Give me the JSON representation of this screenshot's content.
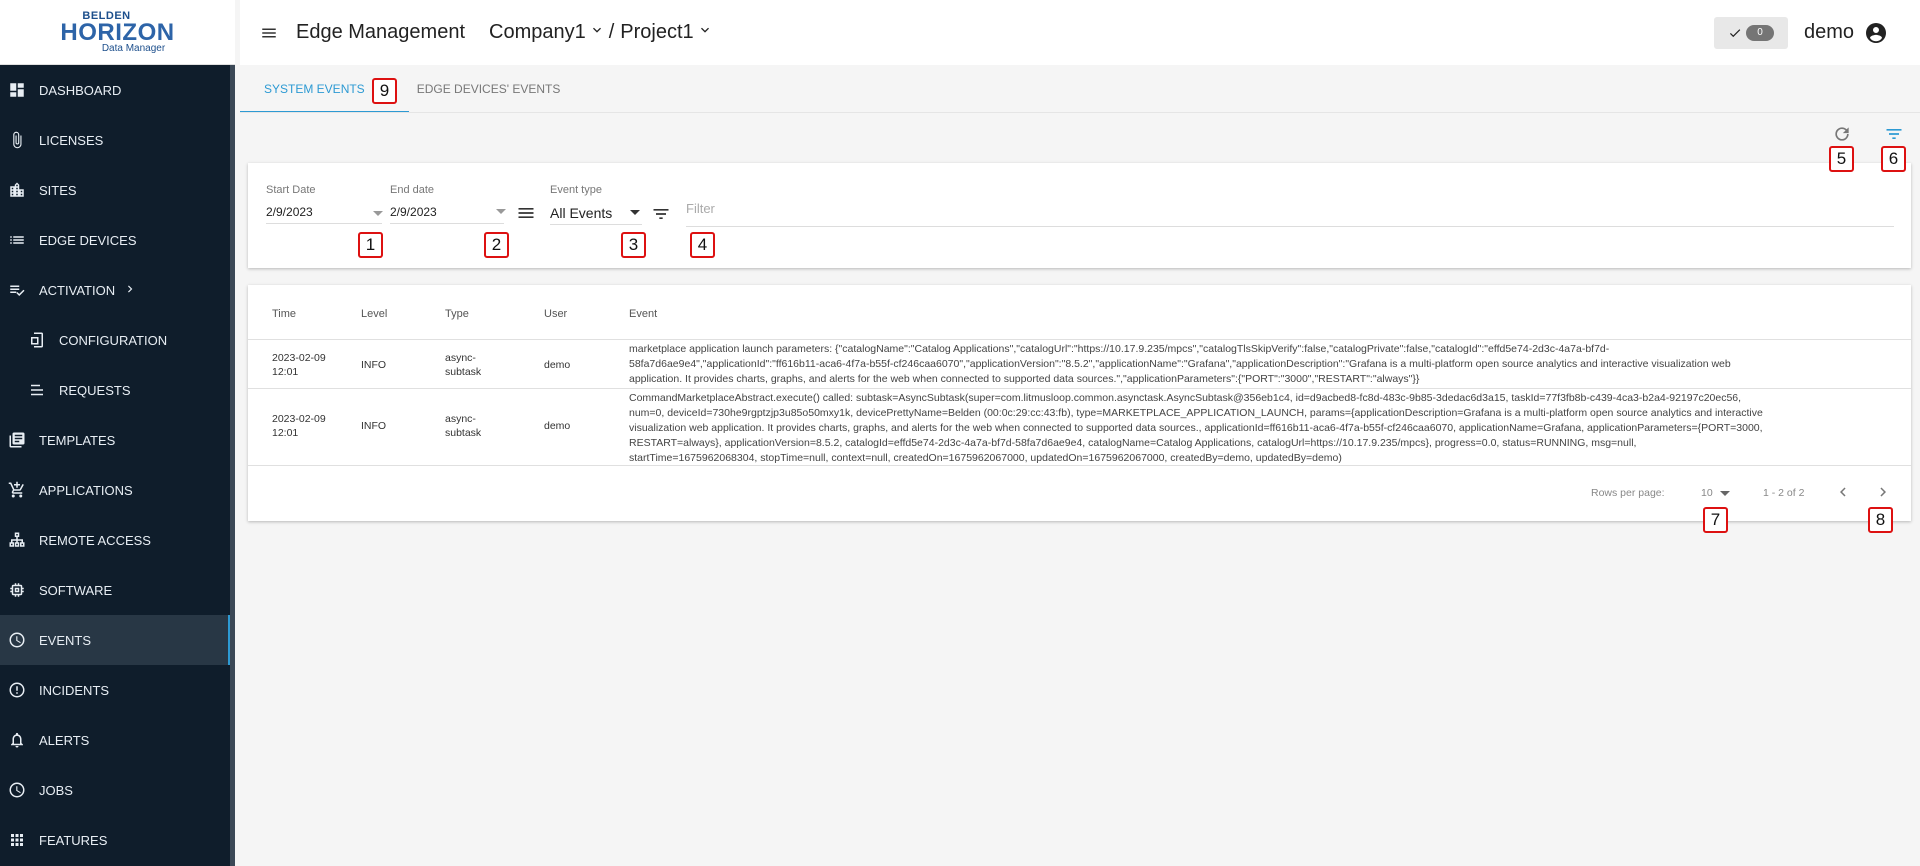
{
  "logo": {
    "line1": "BELDEN",
    "line2": "HORIZON",
    "line3": "Data Manager"
  },
  "sidebar": {
    "items": [
      {
        "label": "DASHBOARD",
        "icon": "dashboard-icon"
      },
      {
        "label": "LICENSES",
        "icon": "paperclip-icon"
      },
      {
        "label": "SITES",
        "icon": "building-icon"
      },
      {
        "label": "EDGE DEVICES",
        "icon": "list-icon"
      },
      {
        "label": "ACTIVATION",
        "icon": "checklist-icon"
      },
      {
        "label": "CONFIGURATION",
        "icon": "config-file-icon"
      },
      {
        "label": "REQUESTS",
        "icon": "list-lines-icon"
      },
      {
        "label": "TEMPLATES",
        "icon": "library-icon"
      },
      {
        "label": "APPLICATIONS",
        "icon": "cart-icon"
      },
      {
        "label": "REMOTE ACCESS",
        "icon": "network-icon"
      },
      {
        "label": "SOFTWARE",
        "icon": "chip-icon"
      },
      {
        "label": "EVENTS",
        "icon": "history-icon"
      },
      {
        "label": "INCIDENTS",
        "icon": "alert-circle-icon"
      },
      {
        "label": "ALERTS",
        "icon": "bell-icon"
      },
      {
        "label": "JOBS",
        "icon": "clock-icon"
      },
      {
        "label": "FEATURES",
        "icon": "apps-grid-icon"
      }
    ]
  },
  "header": {
    "title": "Edge Management",
    "company": "Company1",
    "separator": "/",
    "project": "Project1",
    "badge_count": "0",
    "user": "demo"
  },
  "tabs": [
    {
      "label": "SYSTEM EVENTS",
      "active": true
    },
    {
      "label": "EDGE DEVICES' EVENTS",
      "active": false
    }
  ],
  "filters": {
    "start_label": "Start Date",
    "start_value": "2/9/2023",
    "end_label": "End date",
    "end_value": "2/9/2023",
    "type_label": "Event type",
    "type_value": "All Events",
    "filter_placeholder": "Filter"
  },
  "table": {
    "columns": [
      "Time",
      "Level",
      "Type",
      "User",
      "Event"
    ],
    "rows": [
      {
        "time": "2023-02-09 12:01",
        "level": "INFO",
        "type": "async-subtask",
        "user": "demo",
        "event": "marketplace application launch parameters: {\"catalogName\":\"Catalog Applications\",\"catalogUrl\":\"https://10.17.9.235/mpcs\",\"catalogTlsSkipVerify\":false,\"catalogPrivate\":false,\"catalogId\":\"effd5e74-2d3c-4a7a-bf7d-58fa7d6ae9e4\",\"applicationId\":\"ff616b11-aca6-4f7a-b55f-cf246caa6070\",\"applicationVersion\":\"8.5.2\",\"applicationName\":\"Grafana\",\"applicationDescription\":\"Grafana is a multi-platform open source analytics and interactive visualization web application. It provides charts, graphs, and alerts for the web when connected to supported data sources.\",\"applicationParameters\":{\"PORT\":\"3000\",\"RESTART\":\"always\"}}"
      },
      {
        "time": "2023-02-09 12:01",
        "level": "INFO",
        "type": "async-subtask",
        "user": "demo",
        "event": "CommandMarketplaceAbstract.execute() called: subtask=AsyncSubtask(super=com.litmusloop.common.asynctask.AsyncSubtask@356eb1c4, id=d9acbed8-fc8d-483c-9b85-3dedac6d3a15, taskId=77f3fb8b-c439-4ca3-b2a4-92197c20ec56, num=0, deviceId=730he9rgptzjp3u85o50mxy1k, devicePrettyName=Belden (00:0c:29:cc:43:fb), type=MARKETPLACE_APPLICATION_LAUNCH, params={applicationDescription=Grafana is a multi-platform open source analytics and interactive visualization web application. It provides charts, graphs, and alerts for the web when connected to supported data sources., applicationId=ff616b11-aca6-4f7a-b55f-cf246caa6070, applicationName=Grafana, applicationParameters={PORT=3000, RESTART=always}, applicationVersion=8.5.2, catalogId=effd5e74-2d3c-4a7a-bf7d-58fa7d6ae9e4, catalogName=Catalog Applications, catalogUrl=https://10.17.9.235/mpcs}, progress=0.0, status=RUNNING, msg=null, startTime=1675962068304, stopTime=null, context=null, createdOn=1675962067000, updatedOn=1675962067000, createdBy=demo, updatedBy=demo)"
      }
    ]
  },
  "pagination": {
    "rows_label": "Rows per page:",
    "rows_value": "10",
    "range": "1 - 2 of 2"
  },
  "markers": [
    "1",
    "2",
    "3",
    "4",
    "5",
    "6",
    "7",
    "8",
    "9"
  ],
  "colors": {
    "sidebar_bg": "#0f1d2b",
    "accent": "#2d9ad3",
    "marker_border": "#dd1111"
  }
}
